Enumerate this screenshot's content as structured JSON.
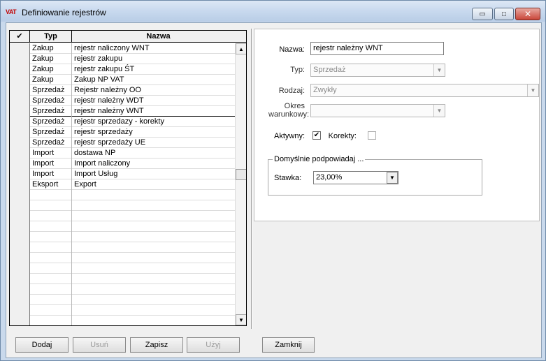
{
  "window": {
    "title": "Definiowanie rejestrów",
    "logo_text": "VAT",
    "controls": {
      "minimize": "▭",
      "maximize": "□",
      "close": "✕"
    }
  },
  "grid": {
    "columns": {
      "check": "✔",
      "typ": "Typ",
      "nazwa": "Nazwa"
    },
    "rows": [
      {
        "typ": "Zakup",
        "nazwa": "rejestr naliczony WNT"
      },
      {
        "typ": "Zakup",
        "nazwa": "rejestr zakupu"
      },
      {
        "typ": "Zakup",
        "nazwa": "rejestr zakupu ŚT"
      },
      {
        "typ": "Zakup",
        "nazwa": "Zakup NP VAT"
      },
      {
        "typ": "Sprzedaż",
        "nazwa": "Rejestr należny OO"
      },
      {
        "typ": "Sprzedaż",
        "nazwa": "rejestr należny WDT"
      },
      {
        "typ": "Sprzedaż",
        "nazwa": "rejestr należny WNT",
        "selected": true
      },
      {
        "typ": "Sprzedaż",
        "nazwa": "rejestr sprzedazy - korekty"
      },
      {
        "typ": "Sprzedaż",
        "nazwa": "rejestr sprzedaży"
      },
      {
        "typ": "Sprzedaż",
        "nazwa": "rejestr sprzedaży UE"
      },
      {
        "typ": "Import",
        "nazwa": "dostawa NP"
      },
      {
        "typ": "Import",
        "nazwa": "Import naliczony"
      },
      {
        "typ": "Import",
        "nazwa": "Import Usług"
      },
      {
        "typ": "Eksport",
        "nazwa": "Export"
      }
    ],
    "empty_rows": 13
  },
  "form": {
    "nazwa": {
      "label": "Nazwa:",
      "value": "rejestr należny WNT"
    },
    "typ": {
      "label": "Typ:",
      "value": "Sprzedaż"
    },
    "rodzaj": {
      "label": "Rodzaj:",
      "value": "Zwykły"
    },
    "okres": {
      "label_line1": "Okres",
      "label_line2": "warunkowy:",
      "value": ""
    },
    "aktywny": {
      "label": "Aktywny:",
      "checked": true
    },
    "korekty": {
      "label": "Korekty:",
      "checked": false
    },
    "group": {
      "title": "Domyślnie podpowiadaj ...",
      "stawka": {
        "label": "Stawka:",
        "value": "23,00%"
      }
    }
  },
  "buttons": {
    "dodaj": "Dodaj",
    "usun": "Usuń",
    "zapisz": "Zapisz",
    "uzyj": "Użyj",
    "zamknij": "Zamknij"
  },
  "icons": {
    "check_header": "check-icon",
    "dropdown": "chevron-down-icon",
    "scroll_up": "arrow-up-icon",
    "scroll_down": "arrow-down-icon"
  },
  "colors": {
    "title_bar": "#c8d9ee",
    "close_button": "#c9473a",
    "logo": "#c00000"
  }
}
